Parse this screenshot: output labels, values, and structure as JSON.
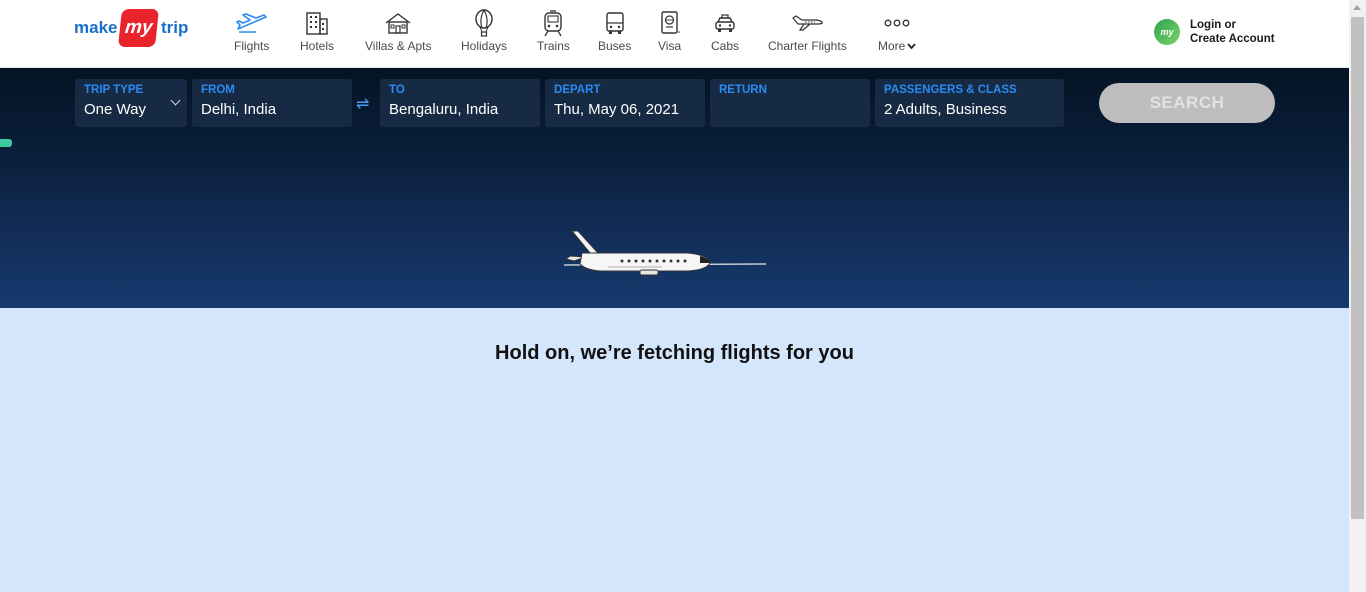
{
  "logo": {
    "part1": "make",
    "part2": "my",
    "part3": "trip"
  },
  "nav": {
    "items": [
      {
        "label": "Flights",
        "icon": "flight-icon"
      },
      {
        "label": "Hotels",
        "icon": "hotel-icon"
      },
      {
        "label": "Villas & Apts",
        "icon": "villa-icon"
      },
      {
        "label": "Holidays",
        "icon": "hot-air-balloon-icon"
      },
      {
        "label": "Trains",
        "icon": "train-icon"
      },
      {
        "label": "Buses",
        "icon": "bus-icon"
      },
      {
        "label": "Visa",
        "icon": "passport-icon"
      },
      {
        "label": "Cabs",
        "icon": "cab-icon"
      },
      {
        "label": "Charter Flights",
        "icon": "charter-plane-icon"
      },
      {
        "label": "More",
        "icon": "more-dots-icon"
      }
    ]
  },
  "login": {
    "avatar_text": "my",
    "line1": "Login or",
    "line2": "Create Account"
  },
  "search": {
    "trip_type": {
      "label": "TRIP TYPE",
      "value": "One Way"
    },
    "from": {
      "label": "FROM",
      "value": "Delhi, India"
    },
    "to": {
      "label": "TO",
      "value": "Bengaluru, India"
    },
    "depart": {
      "label": "DEPART",
      "value": "Thu, May 06, 2021"
    },
    "return": {
      "label": "RETURN",
      "value": ""
    },
    "passengers": {
      "label": "PASSENGERS & CLASS",
      "value": "2 Adults, Business"
    },
    "button": "SEARCH",
    "swap_icon": "⇌"
  },
  "loading": {
    "message": "Hold on, we’re fetching flights for you"
  },
  "colors": {
    "accent": "#2a8bf2",
    "brand_red": "#e8232b",
    "brand_blue": "#1a6fc9",
    "lower_bg": "#d4e6fb",
    "button_disabled": "#bdbdbd"
  }
}
